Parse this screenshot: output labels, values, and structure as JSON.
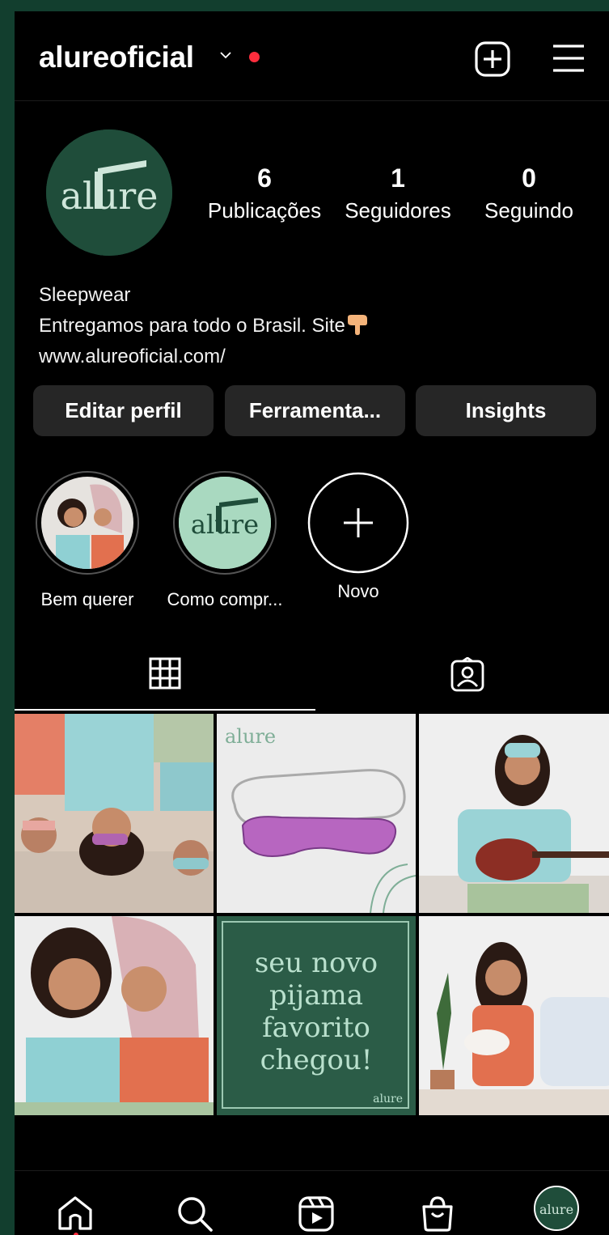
{
  "header": {
    "username": "alureoficial",
    "icons": [
      "chevron-down-icon",
      "notification-dot",
      "new-post-icon",
      "menu-icon"
    ]
  },
  "profile": {
    "logo_text": "alure",
    "stats": [
      {
        "count": "6",
        "label": "Publicações"
      },
      {
        "count": "1",
        "label": "Seguidores"
      },
      {
        "count": "0",
        "label": "Seguindo"
      }
    ],
    "bio": {
      "line1": "Sleepwear",
      "line2": "Entregamos para todo o Brasil. Site",
      "link": "www.alureoficial.com/"
    }
  },
  "actions": {
    "edit": "Editar perfil",
    "tools": "Ferramenta...",
    "insights": "Insights"
  },
  "highlights": [
    {
      "label": "Bem querer"
    },
    {
      "label": "Como compr..."
    },
    {
      "label": "Novo"
    }
  ],
  "tabs": [
    "grid-icon",
    "tagged-icon"
  ],
  "posts": [
    {
      "text": ""
    },
    {
      "text": "alure"
    },
    {
      "text": ""
    },
    {
      "text": ""
    },
    {
      "line1": "seu novo",
      "line2": "pijama",
      "line3": "favorito",
      "line4": "chegou!",
      "logo": "alure"
    },
    {
      "text": ""
    }
  ],
  "bottom_nav": [
    "home-icon",
    "search-icon",
    "reels-icon",
    "shop-icon",
    "profile-avatar"
  ],
  "colors": {
    "brand_green": "#1f4d3a",
    "background": "#000000",
    "button": "#262626",
    "accent_red": "#ff2d3d"
  }
}
